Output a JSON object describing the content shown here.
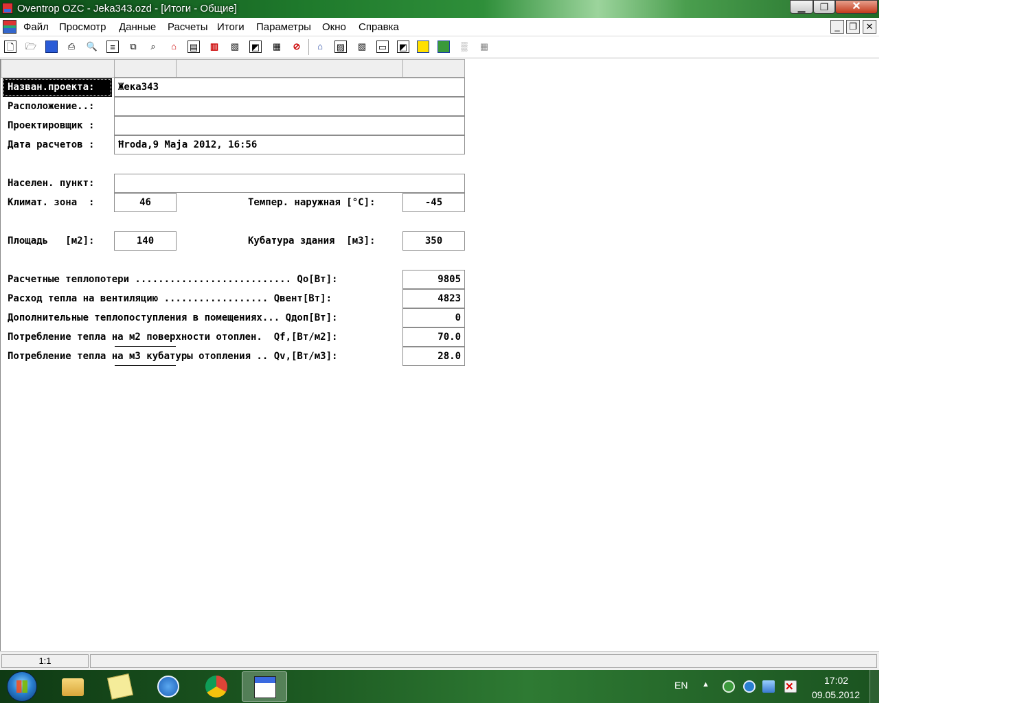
{
  "window": {
    "title": "Oventrop OZC - Jeka343.ozd - [Итоги - Общие]",
    "minimize_icon": "minimize-icon",
    "maximize_icon": "restore-icon",
    "close_icon": "close-icon"
  },
  "menu": {
    "items": [
      "Файл",
      "Просмотр",
      "Данные",
      "Расчеты",
      "Итоги",
      "Параметры",
      "Окно",
      "Справка"
    ],
    "mdi_minimize": "_",
    "mdi_restore": "❐",
    "mdi_close": "✕"
  },
  "toolbar": {
    "icons": [
      "new-file-icon",
      "open-folder-icon",
      "save-icon",
      "print-icon",
      "print-preview-icon",
      "report-icon",
      "copy-icon",
      "find-icon",
      "house-icon",
      "calc-table-icon",
      "radiator-icon",
      "wall-icon",
      "page-icon",
      "calculator-icon",
      "stop-icon",
      "house-blue-icon",
      "hatch-icon",
      "hatch2-icon",
      "window-icon",
      "page2-icon",
      "yellow-panel-icon",
      "map-icon",
      "pattern-icon",
      "grid-icon"
    ]
  },
  "form": {
    "project_name_label": "Назван.проекта:",
    "project_name_value": "Жека343",
    "location_label": "Расположение..:",
    "location_value": "",
    "designer_label": "Проектировщик :",
    "designer_value": "",
    "date_label": "Дата расчетов :",
    "date_value": "Ħroda,9 Maja 2012, 16:56",
    "city_label": "Населен. пункт:",
    "city_value": "",
    "climate_zone_label": "Климат. зона  :",
    "climate_zone_value": "46",
    "outdoor_temp_label": "Темпер. наружная [°C]:",
    "outdoor_temp_value": "-45",
    "area_label": "Площадь   [м2]:",
    "area_value": "140",
    "volume_label": "Кубатура здания  [м3]:",
    "volume_value": "350"
  },
  "results": [
    {
      "label": "Расчетные теплопотери ........................... Qo[Вт]:",
      "value": "9805"
    },
    {
      "label": "Расход тепла на вентиляцию .................. Qвент[Вт]:",
      "value": "4823"
    },
    {
      "label": "Дополнительные теплопоступления в помещениях... Qдоп[Вт]:",
      "value": "0"
    },
    {
      "label": "Потребление тепла на м2 поверхности отоплен.  Qf,[Вт/м2]:",
      "value": "70.0"
    },
    {
      "label": "Потребление тепла на м3 кубатуры отопления .. Qv,[Вт/м3]:",
      "value": "28.0"
    }
  ],
  "status": {
    "zoom": "1:1"
  },
  "taskbar": {
    "language": "EN",
    "time": "17:02",
    "date": "09.05.2012"
  }
}
